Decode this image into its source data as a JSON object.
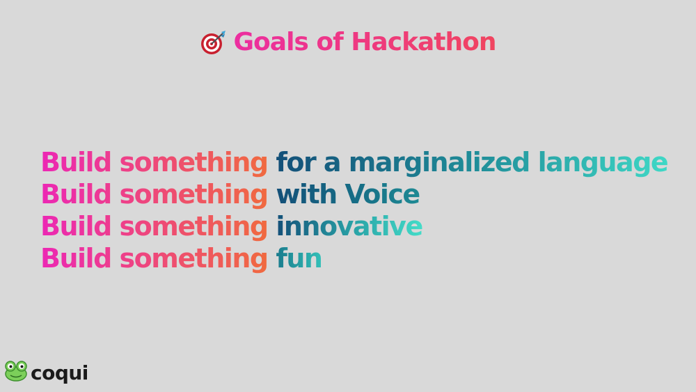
{
  "slide": {
    "title": "Goals of Hackathon",
    "title_icon": "direct-hit-target-icon",
    "goals": [
      {
        "prefix": "Build something",
        "rest": "for a marginalized language"
      },
      {
        "prefix": "Build something",
        "rest": "with Voice"
      },
      {
        "prefix": "Build something",
        "rest": "innovative"
      },
      {
        "prefix": "Build something",
        "rest": "fun"
      }
    ]
  },
  "logo": {
    "text": "coqui",
    "icon": "frog-icon",
    "color": "#1a1a1a",
    "frog_color": "#7ccf5a"
  },
  "colors": {
    "background": "#d9d9d9",
    "pink": "#ec27b4",
    "coral": "#f06a3f",
    "navy": "#134f78",
    "teal": "#3fd8c6"
  }
}
